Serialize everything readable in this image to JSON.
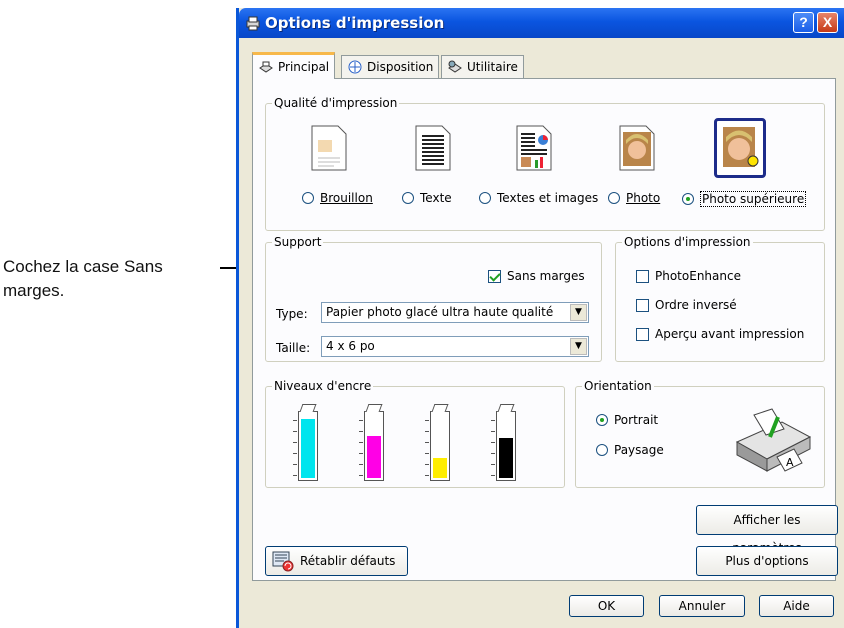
{
  "callout": {
    "text": "Cochez la case Sans marges."
  },
  "window": {
    "title": "Options d'impression",
    "help_label": "?",
    "close_label": "X"
  },
  "tabs": [
    {
      "label": "Principal"
    },
    {
      "label": "Disposition"
    },
    {
      "label": "Utilitaire"
    }
  ],
  "quality": {
    "group_label": "Qualité d'impression",
    "options": [
      {
        "label": "Brouillon",
        "selected": false
      },
      {
        "label": "Texte",
        "selected": false
      },
      {
        "label": "Textes et images",
        "selected": false
      },
      {
        "label": "Photo",
        "selected": false
      },
      {
        "label": "Photo supérieure",
        "selected": true
      }
    ]
  },
  "support": {
    "group_label": "Support",
    "borderless_label": "Sans marges",
    "borderless_checked": true,
    "type_label": "Type:",
    "type_value": "Papier photo glacé ultra haute qualité",
    "size_label": "Taille:",
    "size_value": "4 x 6 po"
  },
  "print_options": {
    "group_label": "Options d'impression",
    "items": [
      {
        "label": "PhotoEnhance",
        "checked": false
      },
      {
        "label": "Ordre inversé",
        "checked": false
      },
      {
        "label": "Aperçu avant impression",
        "checked": false
      }
    ]
  },
  "ink": {
    "group_label": "Niveaux d'encre",
    "cartridges": [
      {
        "color": "#00e5ee",
        "level": 0.92
      },
      {
        "color": "#ff00e6",
        "level": 0.65
      },
      {
        "color": "#ffee00",
        "level": 0.32
      },
      {
        "color": "#000000",
        "level": 0.62
      }
    ]
  },
  "orientation": {
    "group_label": "Orientation",
    "portrait_label": "Portrait",
    "landscape_label": "Paysage",
    "selected": "portrait"
  },
  "buttons": {
    "show_settings": "Afficher les paramètres",
    "reset_defaults": "Rétablir défauts",
    "more_options": "Plus d'options",
    "ok": "OK",
    "cancel": "Annuler",
    "help": "Aide"
  },
  "colors": {
    "titlebar": "#0a55e0",
    "accent": "#21a121"
  }
}
